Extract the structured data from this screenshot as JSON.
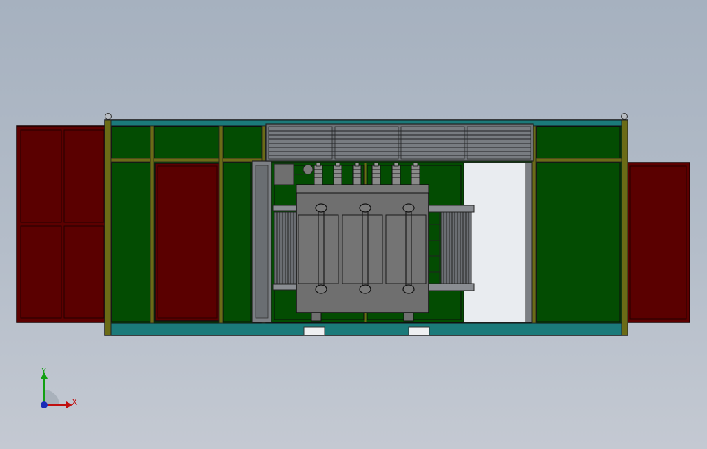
{
  "viewport": {
    "background_top": "#a6b1bf",
    "background_bottom": "#c4c9d2"
  },
  "model": {
    "colors": {
      "panel_green": "#034c02",
      "door_red": "#5c0000",
      "frame_olive": "#6b6b16",
      "base_teal": "#1b7a7a",
      "transformer_gray": "#6f6f6f",
      "vent_gray": "#7c7f84",
      "opening_white": "#e9ecf0"
    }
  },
  "triad": {
    "x_label": "X",
    "y_label": "Y",
    "x_color": "#c01010",
    "y_color": "#12a012",
    "z_color": "#1a2bb8"
  }
}
